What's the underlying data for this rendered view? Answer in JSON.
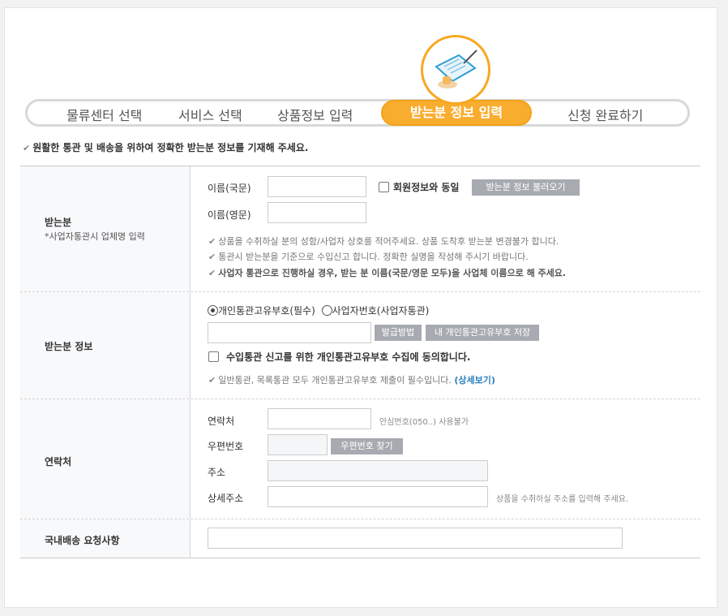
{
  "steps": [
    "물류센터 선택",
    "서비스 선택",
    "상품정보 입력",
    "받는분 정보 입력",
    "신청 완료하기"
  ],
  "notice": "원활한 통관 및 배송을 위하여 정확한 받는분 정보를 기재해 주세요.",
  "recipient": {
    "title": "받는분",
    "subtitle": "*사업자통관시 업체명 입력",
    "name_kr_label": "이름(국문)",
    "name_en_label": "이름(영문)",
    "same_as_member": "회원정보와 동일",
    "load_button": "받는분 정보 불러오기",
    "hints": [
      "상품을 수취하실 분의 성함/사업자 상호를 적어주세요. 상품 도착후 받는분 변경불가 합니다.",
      "통관시 받는분을 기준으로 수입신고 합니다. 정확한 실명을 작성해 주시기 바랍니다.",
      "사업자 통관으로 진행하실 경우, 받는 분 이름(국문/영문 모두)을 사업체 이름으로 해 주세요."
    ]
  },
  "customs": {
    "title": "받는분 정보",
    "radio_personal": "개인통관고유부호(필수)",
    "radio_business": "사업자번호(사업자통관)",
    "issue_button": "발급방법",
    "save_button": "내 개인통관고유부호 저장",
    "consent": "수입통관 신고를 위한 개인통관고유부호 수집에 동의합니다.",
    "hint": "일반통관, 목록통관 모두 개인통관고유부호 제출이 필수입니다.",
    "detail_link": "(상세보기)"
  },
  "contact": {
    "title": "연락처",
    "phone_label": "연락처",
    "phone_hint": "안심번호(050..) 사용불가",
    "zip_label": "우편번호",
    "zip_button": "우편번호 찾기",
    "address_label": "주소",
    "detail_label": "상세주소",
    "detail_hint": "상품을 수취하실 주소를 입력해 주세요."
  },
  "request": {
    "title": "국내배송 요청사항"
  },
  "colors": {
    "accent": "#f9ad2e",
    "button_gray": "#a7abb1",
    "link": "#2a7fbf"
  }
}
